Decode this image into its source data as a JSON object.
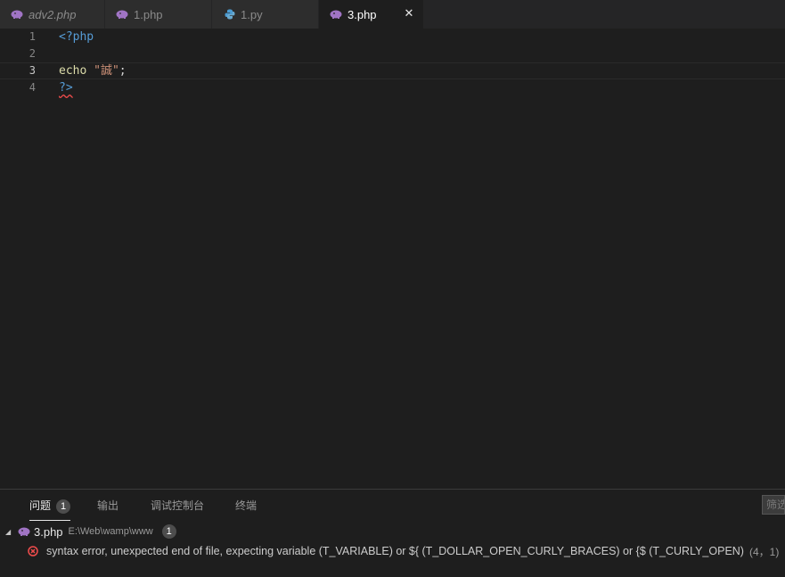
{
  "tabs": [
    {
      "label": "adv2.php",
      "icon": "php-elephant-icon",
      "italic": true,
      "active": false
    },
    {
      "label": "1.php",
      "icon": "php-elephant-icon",
      "italic": false,
      "active": false
    },
    {
      "label": "1.py",
      "icon": "python-icon",
      "italic": false,
      "active": false
    },
    {
      "label": "3.php",
      "icon": "php-elephant-icon",
      "italic": false,
      "active": true,
      "close_glyph": "✕"
    }
  ],
  "editor": {
    "lines": [
      {
        "number": "1",
        "tokens": [
          "<?php"
        ]
      },
      {
        "number": "2",
        "tokens": []
      },
      {
        "number": "3",
        "tokens": [
          "echo",
          " ",
          "\"誠\"",
          ";"
        ]
      },
      {
        "number": "4",
        "tokens": [
          "?>"
        ]
      }
    ],
    "current_line": "3"
  },
  "panel": {
    "tabs": {
      "problems": "问题",
      "problems_count": "1",
      "output": "输出",
      "debug_console": "调试控制台",
      "terminal": "终端"
    },
    "filter_placeholder": "筛选",
    "file": {
      "twisty": "◢",
      "name": "3.php",
      "path": "E:\\Web\\wamp\\www",
      "count": "1"
    },
    "problem": {
      "message": "syntax error, unexpected end of file, expecting variable (T_VARIABLE) or ${ (T_DOLLAR_OPEN_CURLY_BRACES) or {$ (T_CURLY_OPEN)",
      "position": "(4，1)"
    }
  },
  "colors": {
    "php_icon": "#a074c4",
    "python_icon": "#4b9cd3",
    "error": "#f14c4c"
  }
}
